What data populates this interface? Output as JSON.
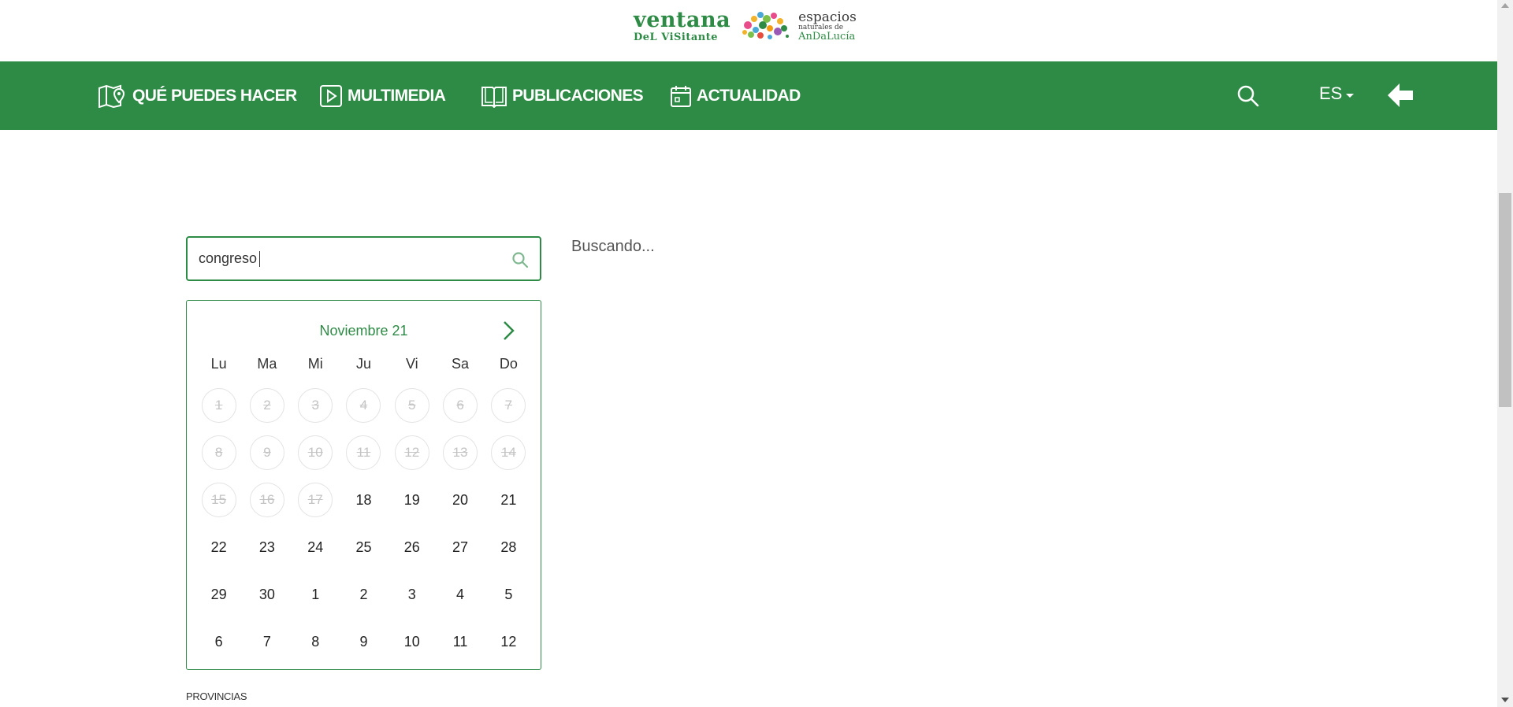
{
  "logo": {
    "line1": "ventana",
    "line2": "DeL ViSitante",
    "brand1": "espacios",
    "brand2": "naturales de",
    "brand3": "AnDaLucía"
  },
  "nav": {
    "items": [
      {
        "label": "QUÉ PUEDES HACER",
        "icon": "map-pin-icon"
      },
      {
        "label": "MULTIMEDIA",
        "icon": "play-icon"
      },
      {
        "label": "PUBLICACIONES",
        "icon": "book-icon"
      },
      {
        "label": "ACTUALIDAD",
        "icon": "calendar-icon"
      }
    ],
    "search_icon": "search-icon",
    "language": "ES",
    "back_icon": "arrow-left-icon",
    "color": "#2e8b46"
  },
  "search": {
    "value": "congreso",
    "icon": "search-icon"
  },
  "status_text": "Buscando...",
  "calendar": {
    "month_label": "Noviembre 21",
    "next_icon": "chevron-right-icon",
    "weekdays": [
      "Lu",
      "Ma",
      "Mi",
      "Ju",
      "Vi",
      "Sa",
      "Do"
    ],
    "days": [
      {
        "n": "1",
        "disabled": true
      },
      {
        "n": "2",
        "disabled": true
      },
      {
        "n": "3",
        "disabled": true
      },
      {
        "n": "4",
        "disabled": true
      },
      {
        "n": "5",
        "disabled": true
      },
      {
        "n": "6",
        "disabled": true
      },
      {
        "n": "7",
        "disabled": true
      },
      {
        "n": "8",
        "disabled": true
      },
      {
        "n": "9",
        "disabled": true
      },
      {
        "n": "10",
        "disabled": true
      },
      {
        "n": "11",
        "disabled": true
      },
      {
        "n": "12",
        "disabled": true
      },
      {
        "n": "13",
        "disabled": true
      },
      {
        "n": "14",
        "disabled": true
      },
      {
        "n": "15",
        "disabled": true
      },
      {
        "n": "16",
        "disabled": true
      },
      {
        "n": "17",
        "disabled": true
      },
      {
        "n": "18",
        "disabled": false
      },
      {
        "n": "19",
        "disabled": false
      },
      {
        "n": "20",
        "disabled": false
      },
      {
        "n": "21",
        "disabled": false
      },
      {
        "n": "22",
        "disabled": false
      },
      {
        "n": "23",
        "disabled": false
      },
      {
        "n": "24",
        "disabled": false
      },
      {
        "n": "25",
        "disabled": false
      },
      {
        "n": "26",
        "disabled": false
      },
      {
        "n": "27",
        "disabled": false
      },
      {
        "n": "28",
        "disabled": false
      },
      {
        "n": "29",
        "disabled": false
      },
      {
        "n": "30",
        "disabled": false
      },
      {
        "n": "1",
        "disabled": false
      },
      {
        "n": "2",
        "disabled": false
      },
      {
        "n": "3",
        "disabled": false
      },
      {
        "n": "4",
        "disabled": false
      },
      {
        "n": "5",
        "disabled": false
      },
      {
        "n": "6",
        "disabled": false
      },
      {
        "n": "7",
        "disabled": false
      },
      {
        "n": "8",
        "disabled": false
      },
      {
        "n": "9",
        "disabled": false
      },
      {
        "n": "10",
        "disabled": false
      },
      {
        "n": "11",
        "disabled": false
      },
      {
        "n": "12",
        "disabled": false
      }
    ]
  },
  "filters": {
    "provincias_label": "PROVINCIAS"
  }
}
